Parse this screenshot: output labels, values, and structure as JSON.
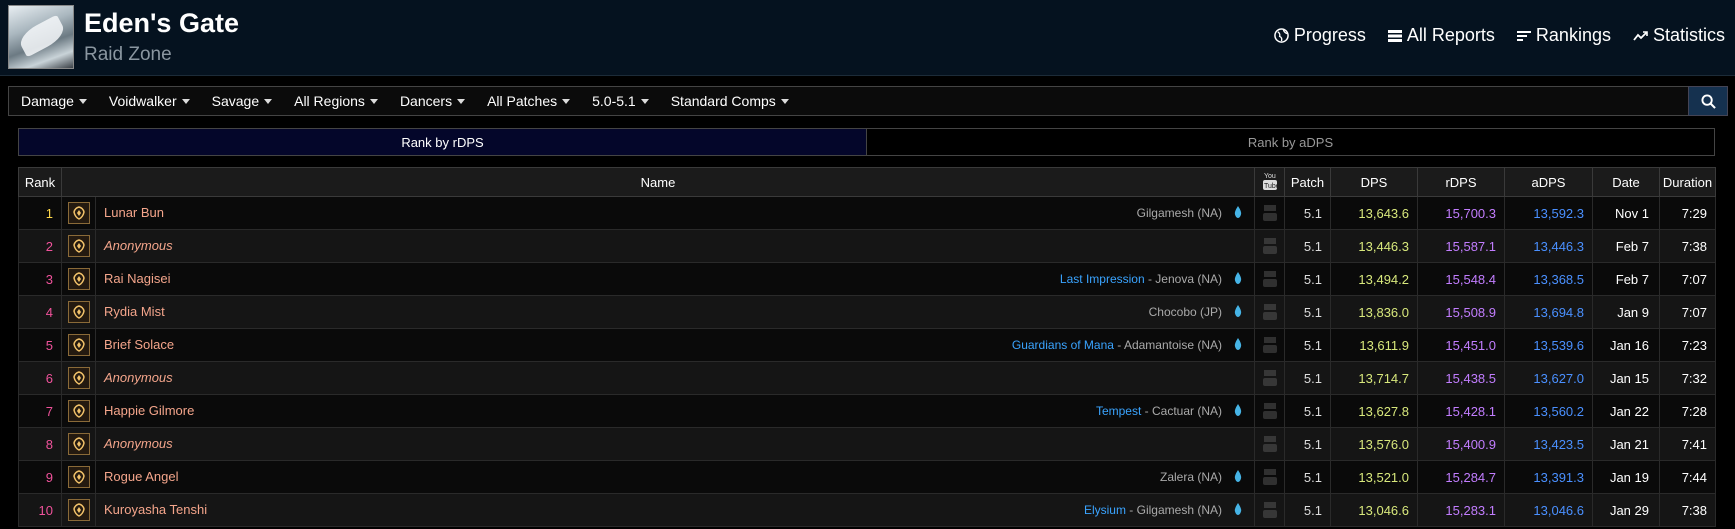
{
  "header": {
    "title": "Eden's Gate",
    "subtitle": "Raid Zone",
    "nav": [
      {
        "label": "Progress",
        "icon": "globe-icon"
      },
      {
        "label": "All Reports",
        "icon": "list-icon"
      },
      {
        "label": "Rankings",
        "icon": "rankings-icon"
      },
      {
        "label": "Statistics",
        "icon": "trend-icon"
      }
    ]
  },
  "filters": [
    "Damage",
    "Voidwalker",
    "Savage",
    "All Regions",
    "Dancers",
    "All Patches",
    "5.0-5.1",
    "Standard Comps"
  ],
  "tabs": {
    "active": "Rank by rDPS",
    "inactive": "Rank by aDPS"
  },
  "columns": {
    "rank": "Rank",
    "name": "Name",
    "patch": "Patch",
    "dps": "DPS",
    "rdps": "rDPS",
    "adps": "aDPS",
    "date": "Date",
    "duration": "Duration"
  },
  "colors": {
    "player": "#f4a58b",
    "guild": "#3aa4ff",
    "dps": "#d8e87c",
    "rdps": "#c27dff",
    "adps": "#4a90ff",
    "rank_top": "#ffd84a",
    "rank": "#f0529b"
  },
  "rows": [
    {
      "rank": "1",
      "name": "Lunar Bun",
      "anonymous": false,
      "guild": "",
      "server": "Gilgamesh (NA)",
      "patch": "5.1",
      "dps": "13,643.6",
      "rdps": "15,700.3",
      "adps": "13,592.3",
      "date": "Nov 1",
      "duration": "7:29"
    },
    {
      "rank": "2",
      "name": "Anonymous",
      "anonymous": true,
      "guild": "",
      "server": "",
      "patch": "5.1",
      "dps": "13,446.3",
      "rdps": "15,587.1",
      "adps": "13,446.3",
      "date": "Feb 7",
      "duration": "7:38"
    },
    {
      "rank": "3",
      "name": "Rai Nagisei",
      "anonymous": false,
      "guild": "Last Impression",
      "server": "Jenova (NA)",
      "patch": "5.1",
      "dps": "13,494.2",
      "rdps": "15,548.4",
      "adps": "13,368.5",
      "date": "Feb 7",
      "duration": "7:07"
    },
    {
      "rank": "4",
      "name": "Rydia Mist",
      "anonymous": false,
      "guild": "",
      "server": "Chocobo (JP)",
      "patch": "5.1",
      "dps": "13,836.0",
      "rdps": "15,508.9",
      "adps": "13,694.8",
      "date": "Jan 9",
      "duration": "7:07"
    },
    {
      "rank": "5",
      "name": "Brief Solace",
      "anonymous": false,
      "guild": "Guardians of Mana",
      "server": "Adamantoise (NA)",
      "patch": "5.1",
      "dps": "13,611.9",
      "rdps": "15,451.0",
      "adps": "13,539.6",
      "date": "Jan 16",
      "duration": "7:23"
    },
    {
      "rank": "6",
      "name": "Anonymous",
      "anonymous": true,
      "guild": "",
      "server": "",
      "patch": "5.1",
      "dps": "13,714.7",
      "rdps": "15,438.5",
      "adps": "13,627.0",
      "date": "Jan 15",
      "duration": "7:32"
    },
    {
      "rank": "7",
      "name": "Happie Gilmore",
      "anonymous": false,
      "guild": "Tempest",
      "server": "Cactuar (NA)",
      "patch": "5.1",
      "dps": "13,627.8",
      "rdps": "15,428.1",
      "adps": "13,560.2",
      "date": "Jan 22",
      "duration": "7:28"
    },
    {
      "rank": "8",
      "name": "Anonymous",
      "anonymous": true,
      "guild": "",
      "server": "",
      "patch": "5.1",
      "dps": "13,576.0",
      "rdps": "15,400.9",
      "adps": "13,423.5",
      "date": "Jan 21",
      "duration": "7:41"
    },
    {
      "rank": "9",
      "name": "Rogue Angel",
      "anonymous": false,
      "guild": "",
      "server": "Zalera (NA)",
      "patch": "5.1",
      "dps": "13,521.0",
      "rdps": "15,284.7",
      "adps": "13,391.3",
      "date": "Jan 19",
      "duration": "7:44"
    },
    {
      "rank": "10",
      "name": "Kuroyasha Tenshi",
      "anonymous": false,
      "guild": "Elysium",
      "server": "Gilgamesh (NA)",
      "patch": "5.1",
      "dps": "13,046.6",
      "rdps": "15,283.1",
      "adps": "13,046.6",
      "date": "Jan 29",
      "duration": "7:38"
    }
  ]
}
